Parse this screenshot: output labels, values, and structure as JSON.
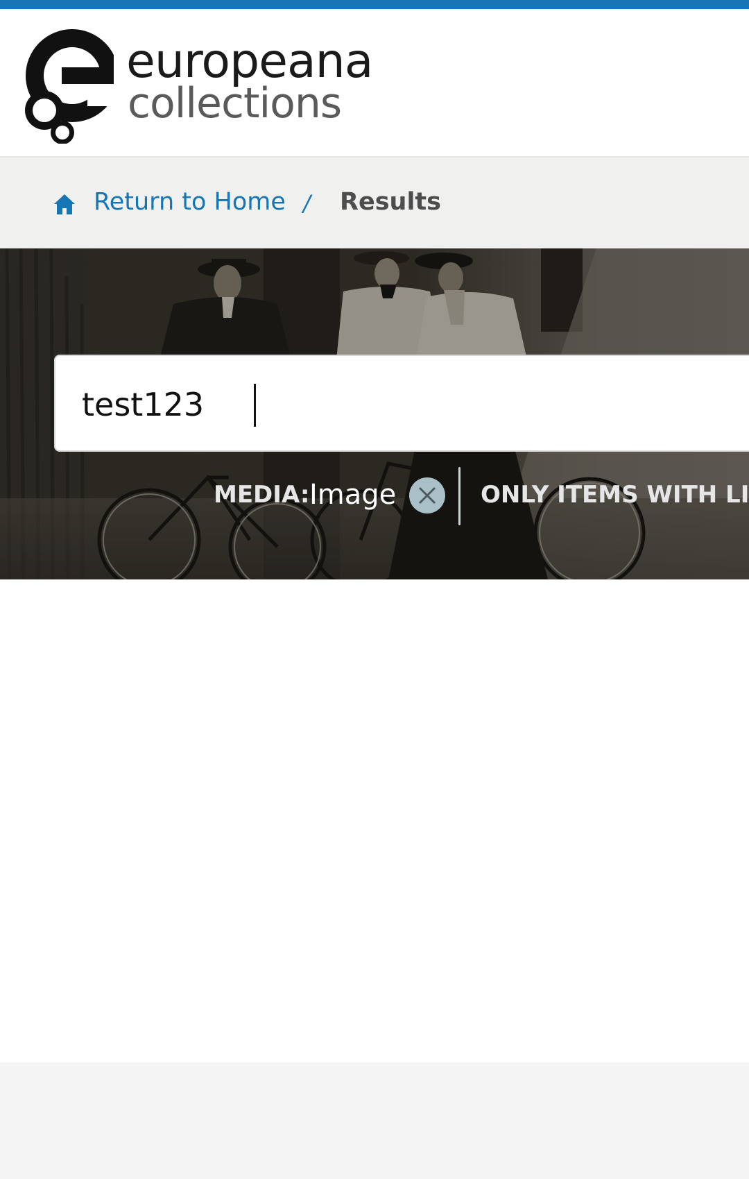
{
  "brand": {
    "name": "europeana",
    "subtitle": "collections",
    "accent_color": "#1676b4"
  },
  "breadcrumb": {
    "home_label": "Return to Home",
    "separator": "/",
    "current": "Results",
    "home_icon": "home-icon"
  },
  "search": {
    "value": "test123",
    "placeholder": ""
  },
  "filters": {
    "media_key": "MEDIA:",
    "media_value": "Image",
    "remove_icon": "close-icon",
    "links_label": "ONLY ITEMS WITH LIN"
  }
}
